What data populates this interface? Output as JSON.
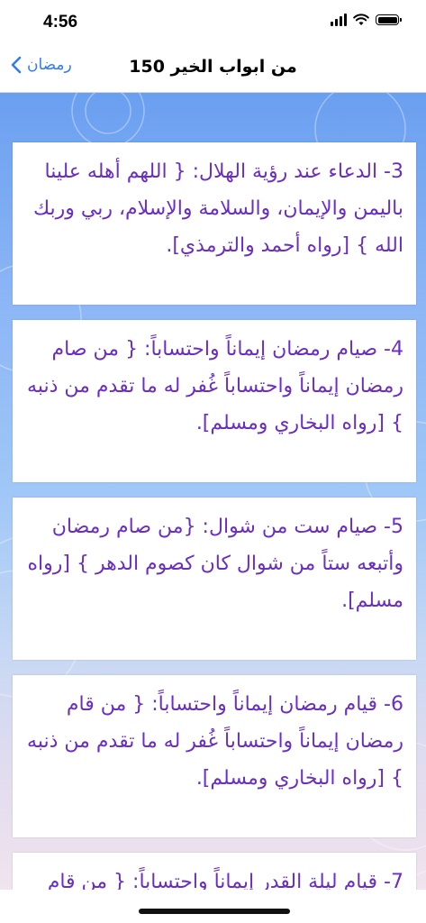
{
  "status_bar": {
    "time": "4:56"
  },
  "nav": {
    "back_label": "رمضان",
    "title": "150 من ابواب الخير"
  },
  "items": [
    {
      "text": "3- الدعاء عند رؤية الهلال: { اللهم أهله علينا باليمن والإيمان، والسلامة والإسلام، ربي وربك الله } [رواه أحمد والترمذي]."
    },
    {
      "text": "4- صيام رمضان إيماناً واحتساباً: { من صام رمضان إيماناً واحتساباً غُفر له ما تقدم من ذنبه } [رواه البخاري ومسلم]."
    },
    {
      "text": "5- صيام ست من شوال: {من صام رمضان وأتبعه ستاً من شوال كان كصوم الدهر } [رواه مسلم]."
    },
    {
      "text": "6- قيام رمضان إيماناً واحتساباً: { من قام رمضان إيماناً واحتساباً غُفر له ما تقدم من ذنبه } [رواه البخاري ومسلم]."
    },
    {
      "text": "7- قيام ليلة القدر إيماناً واحتساباً: { من قام"
    }
  ],
  "colors": {
    "accent": "#2f7cf6",
    "item_text": "#6a2fc0"
  }
}
